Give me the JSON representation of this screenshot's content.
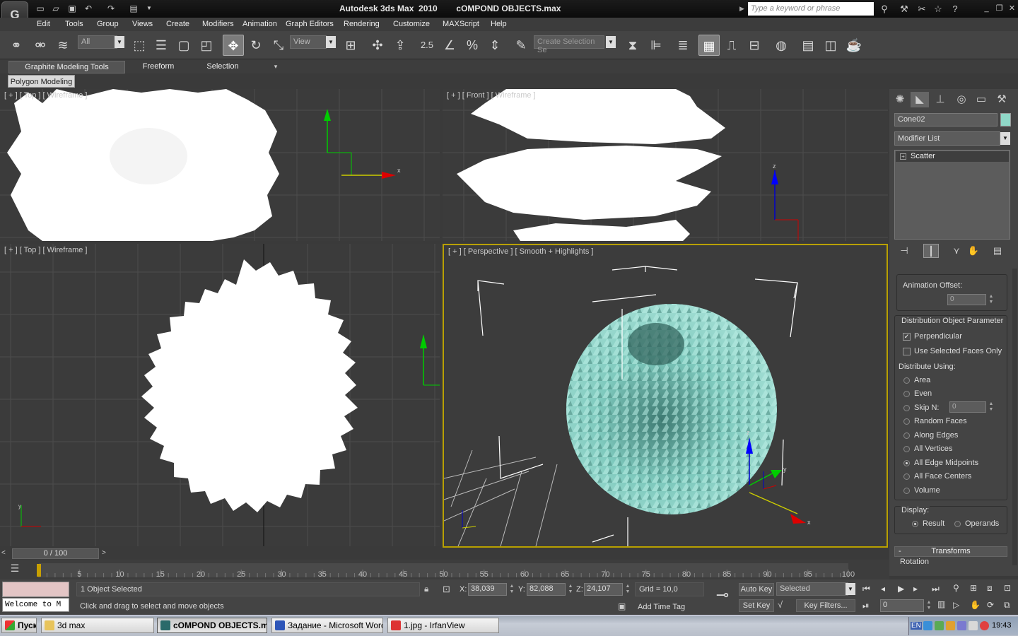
{
  "window": {
    "title": "Autodesk 3ds Max  2010        cOMPOND OBJECTS.max",
    "search_placeholder": "Type a keyword or phrase"
  },
  "menu": [
    "Edit",
    "Tools",
    "Group",
    "Views",
    "Create",
    "Modifiers",
    "Animation",
    "Graph Editors",
    "Rendering",
    "Customize",
    "MAXScript",
    "Help"
  ],
  "toolbar": {
    "filter": "All",
    "ref_coord": "View",
    "snap_value": "2.5",
    "selection_set": "Create Selection Se"
  },
  "ribbon": {
    "tabs": [
      "Graphite Modeling Tools",
      "Freeform",
      "Selection"
    ],
    "panel": "Polygon Modeling"
  },
  "viewports": {
    "top_small": "[ + ] [ Top ] [ Wireframe ]",
    "front": "[ + ] [ Front ] [ Wireframe ]",
    "top": "[ + ] [ Top ] [ Wireframe ]",
    "perspective": "[ + ] [ Perspective ] [ Smooth + Highlights ]"
  },
  "command_panel": {
    "object_name": "Cone02",
    "object_color": "#90d8c8",
    "modifier_list": "Modifier List",
    "stack_item": "Scatter",
    "animation_offset_label": "Animation Offset:",
    "animation_offset_value": "0",
    "dist_group_title": "Distribution Object Parameter",
    "perpendicular": "Perpendicular",
    "use_selected": "Use Selected Faces Only",
    "distribute_using": "Distribute Using:",
    "options": [
      "Area",
      "Even",
      "Skip N:",
      "Random Faces",
      "Along Edges",
      "All Vertices",
      "All Edge Midpoints",
      "All Face Centers",
      "Volume"
    ],
    "selected_option": "All Edge Midpoints",
    "skip_n_value": "0",
    "display_label": "Display:",
    "display_result": "Result",
    "display_operands": "Operands",
    "transforms_title": "Transforms",
    "rotation_label": "Rotation"
  },
  "timeline": {
    "frame_counter": "0 / 100",
    "ticks": [
      "5",
      "10",
      "15",
      "20",
      "25",
      "30",
      "35",
      "40",
      "45",
      "50",
      "55",
      "60",
      "65",
      "70",
      "75",
      "80",
      "85",
      "90",
      "95",
      "100"
    ]
  },
  "status": {
    "selected": "1 Object Selected",
    "prompt": "Click and drag to select and move objects",
    "maxscript": "Welcome to M",
    "x_label": "X:",
    "x_value": "38,039",
    "y_label": "Y:",
    "y_value": "82,088",
    "z_label": "Z:",
    "z_value": "24,107",
    "grid": "Grid = 10,0",
    "add_time_tag": "Add Time Tag",
    "auto_key": "Auto Key",
    "set_key": "Set Key",
    "key_mode": "Selected",
    "key_filters": "Key Filters...",
    "frame_value": "0"
  },
  "taskbar": {
    "start": "Пуск",
    "tasks": [
      "3d max",
      "cOMPOND OBJECTS.m...",
      "Задание - Microsoft Word",
      "1.jpg - IrfanView"
    ],
    "lang": "EN",
    "time": "19:43"
  }
}
